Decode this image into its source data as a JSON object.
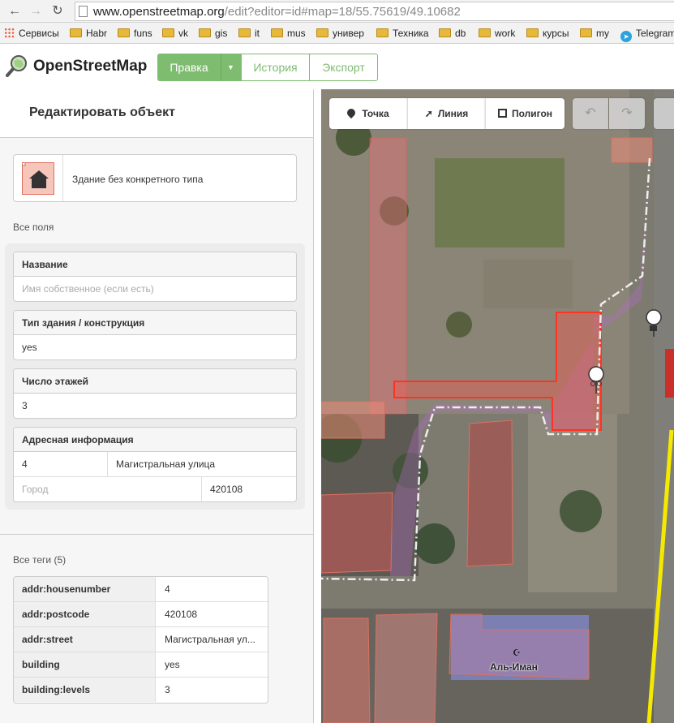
{
  "browser": {
    "url_host": "www.openstreetmap.org",
    "url_rest": "/edit?editor=id#map=18/55.75619/49.10682",
    "bookmarks": [
      "Сервисы",
      "Habr",
      "funs",
      "vk",
      "gis",
      "it",
      "mus",
      "универ",
      "Техника",
      "db",
      "work",
      "курсы",
      "my",
      "Telegram"
    ]
  },
  "header": {
    "logo_text": "OpenStreetMap",
    "edit_label": "Правка",
    "history_label": "История",
    "export_label": "Экспорт",
    "accent": "#7ebc6f"
  },
  "sidebar": {
    "title": "Редактировать объект",
    "preset_label": "Здание без конкретного типа",
    "all_fields_label": "Все поля",
    "fields": {
      "name_label": "Название",
      "name_placeholder": "Имя собственное (если есть)",
      "building_label": "Тип здания / конструкция",
      "building_value": "yes",
      "levels_label": "Число этажей",
      "levels_value": "3",
      "address_label": "Адресная информация",
      "housenumber": "4",
      "street": "Магистральная улица",
      "city_placeholder": "Город",
      "postcode": "420108"
    },
    "all_tags_label": "Все теги (5)",
    "tags": [
      {
        "key": "addr:housenumber",
        "value": "4"
      },
      {
        "key": "addr:postcode",
        "value": "420108"
      },
      {
        "key": "addr:street",
        "value": "Магистральная ул..."
      },
      {
        "key": "building",
        "value": "yes"
      },
      {
        "key": "building:levels",
        "value": "3"
      }
    ]
  },
  "map": {
    "toolbar": {
      "point": "Точка",
      "line": "Линия",
      "area": "Полигон"
    },
    "label_mosque": "Аль-Иман"
  }
}
